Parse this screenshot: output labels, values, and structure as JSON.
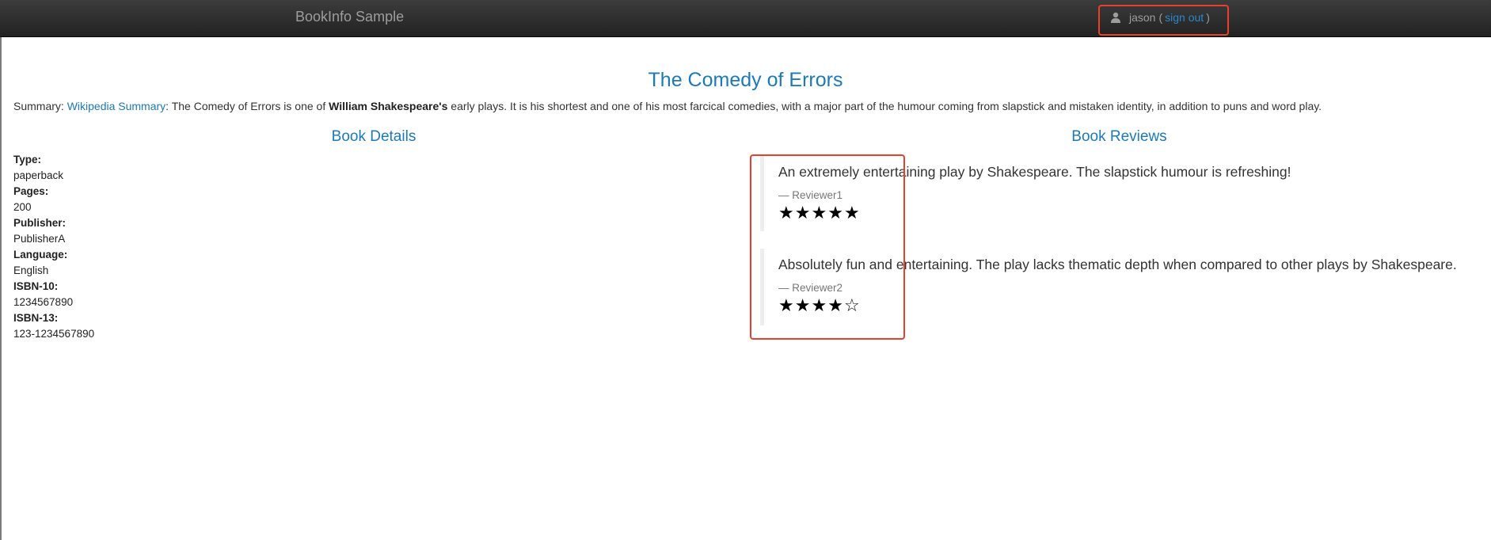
{
  "navbar": {
    "brand": "BookInfo Sample",
    "user": {
      "name": "jason",
      "open_paren": "(",
      "sign_out": "sign out",
      "close_paren": ")"
    }
  },
  "book": {
    "title": "The Comedy of Errors",
    "summary": {
      "prefix": "Summary: ",
      "link_text": "Wikipedia Summary",
      "text_before_bold": ": The Comedy of Errors is one of ",
      "bold": "William Shakespeare's",
      "text_after_bold": " early plays. It is his shortest and one of his most farcical comedies, with a major part of the humour coming from slapstick and mistaken identity, in addition to puns and word play."
    }
  },
  "details": {
    "heading": "Book Details",
    "items": [
      {
        "label": "Type:",
        "value": "paperback"
      },
      {
        "label": "Pages:",
        "value": "200"
      },
      {
        "label": "Publisher:",
        "value": "PublisherA"
      },
      {
        "label": "Language:",
        "value": "English"
      },
      {
        "label": "ISBN-10:",
        "value": "1234567890"
      },
      {
        "label": "ISBN-13:",
        "value": "123-1234567890"
      }
    ]
  },
  "reviews": {
    "heading": "Book Reviews",
    "items": [
      {
        "text": "An extremely entertaining play by Shakespeare. The slapstick humour is refreshing!",
        "reviewer": "— Reviewer1",
        "rating": 5,
        "max_rating": 5
      },
      {
        "text": "Absolutely fun and entertaining. The play lacks thematic depth when compared to other plays by Shakespeare.",
        "reviewer": "— Reviewer2",
        "rating": 4,
        "max_rating": 5
      }
    ]
  },
  "colors": {
    "link": "#1b7ab9",
    "highlight_box": "#e8412b",
    "navbar": "#222222"
  },
  "icons": {
    "user": "user-icon",
    "star_filled": "star-filled-icon",
    "star_empty": "star-empty-icon"
  }
}
